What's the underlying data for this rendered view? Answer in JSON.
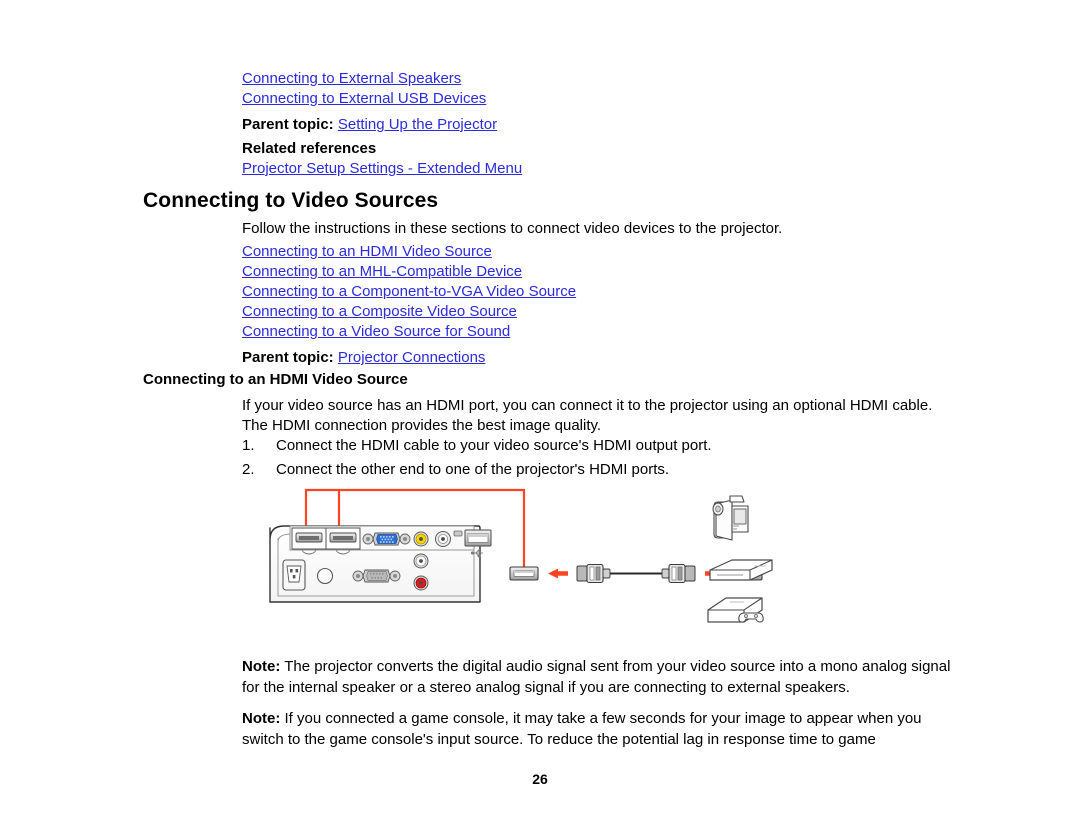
{
  "document": {
    "page_number": "26"
  },
  "top_links": [
    "Connecting to External Speakers",
    "Connecting to External USB Devices"
  ],
  "parent_topic_1": {
    "label": "Parent topic:",
    "value": "Setting Up the Projector"
  },
  "related_references": {
    "heading": "Related references",
    "link": "Projector Setup Settings - Extended Menu"
  },
  "section": {
    "title": "Connecting to Video Sources",
    "intro": "Follow the instructions in these sections to connect video devices to the projector.",
    "links": [
      "Connecting to an HDMI Video Source",
      "Connecting to an MHL-Compatible Device",
      "Connecting to a Component-to-VGA Video Source",
      "Connecting to a Composite Video Source",
      "Connecting to a Video Source for Sound"
    ],
    "parent_topic": {
      "label": "Parent topic:",
      "value": "Projector Connections"
    }
  },
  "subsection": {
    "title": "Connecting to an HDMI Video Source",
    "intro": "If your video source has an HDMI port, you can connect it to the projector using an optional HDMI cable. The HDMI connection provides the best image quality.",
    "steps": [
      {
        "num": "1.",
        "text": "Connect the HDMI cable to your video source's HDMI output port."
      },
      {
        "num": "2.",
        "text": "Connect the other end to one of the projector's HDMI ports."
      }
    ]
  },
  "notes": [
    {
      "label": "Note:",
      "text": " The projector converts the digital audio signal sent from your video source into a mono analog signal for the internal speaker or a stereo analog signal if you are connecting to external speakers."
    },
    {
      "label": "Note:",
      "text": " If you connected a game console, it may take a few seconds for your image to appear when you switch to the game console's input source. To reduce the potential lag in response time to game"
    }
  ],
  "figure": {
    "name": "projector-hdmi-connection-diagram",
    "callout_color": "#ff4422",
    "elements": [
      "projector-rear-panel",
      "hdmi-port-1",
      "hdmi-port-2",
      "vga-port",
      "rca-video-yellow",
      "rca-audio-white",
      "rca-audio-red",
      "mono-jack",
      "usb-a-port",
      "power-inlet",
      "serial-port",
      "hdmi-cable",
      "camcorder-device",
      "media-player-device",
      "game-console-device"
    ]
  },
  "colors": {
    "link": "#2b2bdd",
    "text": "#000000",
    "callout": "#ff4422",
    "vga_blue": "#2b6fd4",
    "rca_yellow": "#ffd400",
    "rca_red": "#e01b1b"
  }
}
